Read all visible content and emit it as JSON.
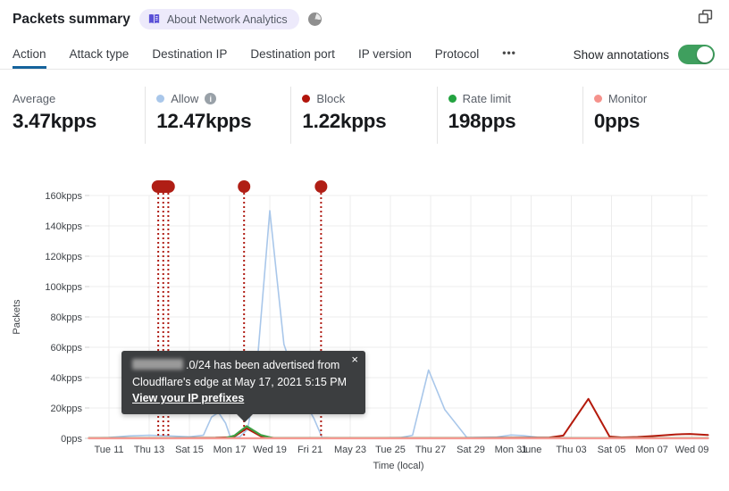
{
  "header": {
    "title": "Packets summary",
    "badge_label": "About Network Analytics"
  },
  "tabs": {
    "items": [
      {
        "label": "Action",
        "active": true
      },
      {
        "label": "Attack type",
        "active": false
      },
      {
        "label": "Destination IP",
        "active": false
      },
      {
        "label": "Destination port",
        "active": false
      },
      {
        "label": "IP version",
        "active": false
      },
      {
        "label": "Protocol",
        "active": false
      }
    ],
    "more": "•••",
    "annotations_label": "Show annotations",
    "toggle_on": true,
    "toggle_color": "#3f9f5e"
  },
  "stats": [
    {
      "label": "Average",
      "value": "3.47kpps"
    },
    {
      "label": "Allow",
      "value": "12.47kpps",
      "dot": "#a9c7ea",
      "info": true
    },
    {
      "label": "Block",
      "value": "1.22kpps",
      "dot": "#b2140b"
    },
    {
      "label": "Rate limit",
      "value": "198pps",
      "dot": "#23a340"
    },
    {
      "label": "Monitor",
      "value": "0pps",
      "dot": "#f5928c"
    }
  ],
  "chart_data": {
    "type": "line",
    "xlabel": "Time (local)",
    "ylabel": "Packets",
    "x_unit": "day of May 2021 (32 = Jun 1, 34 = Jun 3)",
    "y_unit": "kpps",
    "ylim": [
      0,
      160
    ],
    "grid": true,
    "yticks": [
      {
        "v": 0,
        "label": "0pps"
      },
      {
        "v": 20,
        "label": "20kpps"
      },
      {
        "v": 40,
        "label": "40kpps"
      },
      {
        "v": 60,
        "label": "60kpps"
      },
      {
        "v": 80,
        "label": "80kpps"
      },
      {
        "v": 100,
        "label": "100kpps"
      },
      {
        "v": 120,
        "label": "120kpps"
      },
      {
        "v": 140,
        "label": "140kpps"
      },
      {
        "v": 160,
        "label": "160kpps"
      }
    ],
    "xticks": [
      {
        "day": 11,
        "label": "Tue 11"
      },
      {
        "day": 13,
        "label": "Thu 13"
      },
      {
        "day": 15,
        "label": "Sat 15"
      },
      {
        "day": 17,
        "label": "Mon 17"
      },
      {
        "day": 19,
        "label": "Wed 19"
      },
      {
        "day": 21,
        "label": "Fri 21"
      },
      {
        "day": 23,
        "label": "May 23"
      },
      {
        "day": 25,
        "label": "Tue 25"
      },
      {
        "day": 27,
        "label": "Thu 27"
      },
      {
        "day": 29,
        "label": "Sat 29"
      },
      {
        "day": 31,
        "label": "Mon 31"
      },
      {
        "day": 32,
        "label": "June"
      },
      {
        "day": 34,
        "label": "Thu 03"
      },
      {
        "day": 36,
        "label": "Sat 05"
      },
      {
        "day": 38,
        "label": "Mon 07"
      },
      {
        "day": 40,
        "label": "Wed 09"
      }
    ],
    "series": [
      {
        "name": "Allow",
        "color": "#a9c7ea",
        "points": [
          [
            10.0,
            0.3
          ],
          [
            11,
            0.6
          ],
          [
            12,
            1.6
          ],
          [
            13,
            2.0
          ],
          [
            14,
            1.6
          ],
          [
            15,
            1.0
          ],
          [
            15.7,
            2
          ],
          [
            16.1,
            14
          ],
          [
            16.45,
            17
          ],
          [
            16.8,
            10
          ],
          [
            17.05,
            0.4
          ],
          [
            17.5,
            1
          ],
          [
            17.9,
            6
          ],
          [
            18.3,
            38
          ],
          [
            19.0,
            150
          ],
          [
            19.7,
            62
          ],
          [
            20.6,
            27
          ],
          [
            21.2,
            13
          ],
          [
            21.6,
            0.5
          ],
          [
            22.5,
            0.3
          ],
          [
            24,
            0.3
          ],
          [
            25.5,
            0.5
          ],
          [
            26.1,
            2
          ],
          [
            26.9,
            45
          ],
          [
            27.7,
            19
          ],
          [
            28.8,
            0.6
          ],
          [
            30.3,
            0.9
          ],
          [
            31.0,
            2.2
          ],
          [
            31.6,
            1.8
          ],
          [
            32.3,
            0.7
          ],
          [
            34,
            0.4
          ],
          [
            36,
            0.3
          ],
          [
            38,
            0.3
          ],
          [
            40.8,
            0.3
          ]
        ]
      },
      {
        "name": "Block",
        "color": "#b41a0c",
        "points": [
          [
            10.0,
            0.25
          ],
          [
            14,
            0.25
          ],
          [
            16.3,
            0.4
          ],
          [
            17.2,
            0.8
          ],
          [
            17.85,
            6.5
          ],
          [
            18.6,
            1.0
          ],
          [
            19.2,
            0.3
          ],
          [
            22,
            0.25
          ],
          [
            26,
            0.3
          ],
          [
            29,
            0.3
          ],
          [
            31.5,
            0.4
          ],
          [
            32.9,
            0.5
          ],
          [
            33.6,
            1.8
          ],
          [
            34.85,
            26
          ],
          [
            35.9,
            1.2
          ],
          [
            36.5,
            0.6
          ],
          [
            37.3,
            0.9
          ],
          [
            38.2,
            1.6
          ],
          [
            39.2,
            2.6
          ],
          [
            39.9,
            2.9
          ],
          [
            40.4,
            2.5
          ],
          [
            40.8,
            2.2
          ]
        ]
      },
      {
        "name": "Rate limit",
        "color": "#3da043",
        "points": [
          [
            10.0,
            0.15
          ],
          [
            16.8,
            0.2
          ],
          [
            17.25,
            1.8
          ],
          [
            17.85,
            8
          ],
          [
            18.55,
            2.2
          ],
          [
            19.15,
            0.15
          ],
          [
            40.8,
            0.15
          ]
        ]
      },
      {
        "name": "Monitor",
        "color": "#f59a93",
        "points": [
          [
            10.0,
            0.05
          ],
          [
            40.8,
            0.05
          ]
        ]
      }
    ],
    "annotations": {
      "color": "#b01e15",
      "items": [
        {
          "kind": "cluster",
          "days": [
            13.45,
            13.7,
            13.95
          ]
        },
        {
          "kind": "point",
          "day": 17.72
        },
        {
          "kind": "point",
          "day": 21.55
        }
      ]
    }
  },
  "tooltip": {
    "line1_suffix": ".0/24 has been advertised from",
    "line2": "Cloudflare's edge at May 17, 2021 5:15 PM",
    "link": "View your IP prefixes",
    "close": "×"
  }
}
